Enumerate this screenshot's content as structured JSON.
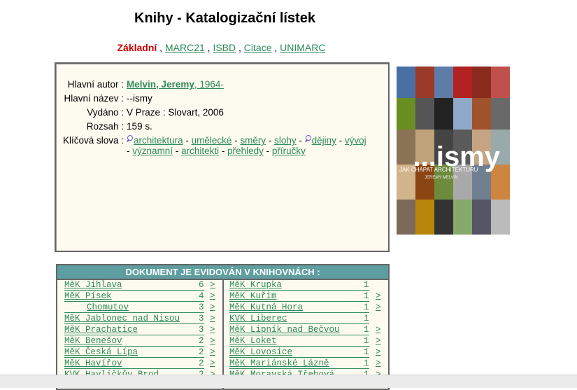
{
  "page": {
    "title": "Knihy - Katalogizační lístek"
  },
  "formats": [
    {
      "label": "Základní",
      "active": true
    },
    {
      "label": "MARC21",
      "active": false
    },
    {
      "label": "ISBD",
      "active": false
    },
    {
      "label": "Citace",
      "active": false
    },
    {
      "label": "UNIMARC",
      "active": false
    }
  ],
  "record": {
    "author_label": "Hlavní autor :",
    "author_name": "Melvin, Jeremy",
    "author_dates": ", 1964-",
    "title_label": "Hlavní název :",
    "title_value": "--ismy",
    "published_label": "Vydáno :",
    "published_value": "V Praze : Slovart, 2006",
    "extent_label": "Rozsah :",
    "extent_value": "159 s.",
    "keywords_label": "Klíčová slova :",
    "keywords": [
      "architektura",
      "umělecké",
      "směry",
      "slohy",
      "dějiny",
      "vývoj",
      "významní",
      "architekti",
      "přehledy",
      "příručky"
    ]
  },
  "cover": {
    "title": "...ismy",
    "subtitle": "JAK CHÁPAT ARCHITEKTURU",
    "author": "JEREMY MELVIN"
  },
  "holdings": {
    "header": "DOKUMENT JE EVIDOVÁN V KNIHOVNÁCH :",
    "link_symbol": ">",
    "left": [
      {
        "name": "MěK Jihlava",
        "count": "6"
      },
      {
        "name": "MěK Písek",
        "count": "4"
      },
      {
        "name": "Chomutov",
        "count": "3"
      },
      {
        "name": "MěK Jablonec nad Nisou",
        "count": "3"
      },
      {
        "name": "MěK Prachatice",
        "count": "3"
      },
      {
        "name": "MěK Benešov",
        "count": "2"
      },
      {
        "name": "MěK Česká Lípa",
        "count": "2"
      },
      {
        "name": "MěK Havířov",
        "count": "2"
      },
      {
        "name": "KVK Havlíčkův Brod",
        "count": "2"
      }
    ],
    "right": [
      {
        "name": "MěK Krupka",
        "count": "1"
      },
      {
        "name": "MěK Kuřim",
        "count": "1"
      },
      {
        "name": "MěK Kutná Hora",
        "count": "1"
      },
      {
        "name": "KVK Liberec",
        "count": "1"
      },
      {
        "name": "MěK Lipník nad Bečvou",
        "count": "1"
      },
      {
        "name": "MěK Loket",
        "count": "1"
      },
      {
        "name": "MěK Lovosice",
        "count": "1"
      },
      {
        "name": "MěK Mariánské Lázně",
        "count": "1"
      },
      {
        "name": "MěK Moravská Třebová",
        "count": "1"
      }
    ]
  },
  "colors": {
    "link": "#2e8b57",
    "active_format": "#cc0000",
    "holdings_header": "#5f9ea0",
    "panel_bg": "#fdfaf0"
  }
}
